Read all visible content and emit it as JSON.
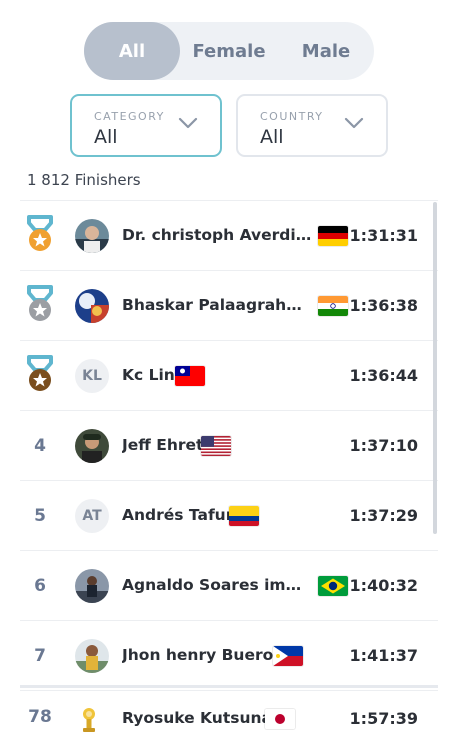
{
  "filters": {
    "gender": {
      "options": [
        "All",
        "Female",
        "Male"
      ],
      "selected": "All"
    },
    "category": {
      "label": "CATEGORY",
      "value": "All"
    },
    "country": {
      "label": "COUNTRY",
      "value": "All"
    }
  },
  "summary": {
    "finishers": "1 812 Finishers"
  },
  "colors": {
    "accent": "#6fc2cf",
    "medal_ribbon": "#5fb6cf",
    "gold": "#f0a030",
    "silver": "#9b9ea3",
    "bronze": "#7a4e1e"
  },
  "results": [
    {
      "rank": "",
      "medal": "gold",
      "avatar": "photo",
      "name": "Dr. christoph Averdiek...",
      "flag": "de",
      "time": "1:31:31"
    },
    {
      "rank": "",
      "medal": "silver",
      "avatar": "photo",
      "name": "Bhaskar Palaagrahara...",
      "flag": "in",
      "time": "1:36:38"
    },
    {
      "rank": "",
      "medal": "bronze",
      "avatar": "KL",
      "name": "Kc Lin",
      "flag": "tw",
      "time": "1:36:44"
    },
    {
      "rank": "4",
      "medal": "",
      "avatar": "photo",
      "name": "Jeff Ehret",
      "flag": "us",
      "time": "1:37:10"
    },
    {
      "rank": "5",
      "medal": "",
      "avatar": "AT",
      "name": "Andrés Tafur",
      "flag": "co",
      "time": "1:37:29"
    },
    {
      "rank": "6",
      "medal": "",
      "avatar": "photo",
      "name": "Agnaldo Soares imperi...",
      "flag": "br",
      "time": "1:40:32"
    },
    {
      "rank": "7",
      "medal": "",
      "avatar": "photo",
      "name": "Jhon henry Bueron",
      "flag": "ph",
      "time": "1:41:37"
    }
  ],
  "pinned": {
    "rank": "78",
    "avatar": "trophy",
    "name": "Ryosuke Kutsuna",
    "flag": "jp",
    "time": "1:57:39"
  }
}
